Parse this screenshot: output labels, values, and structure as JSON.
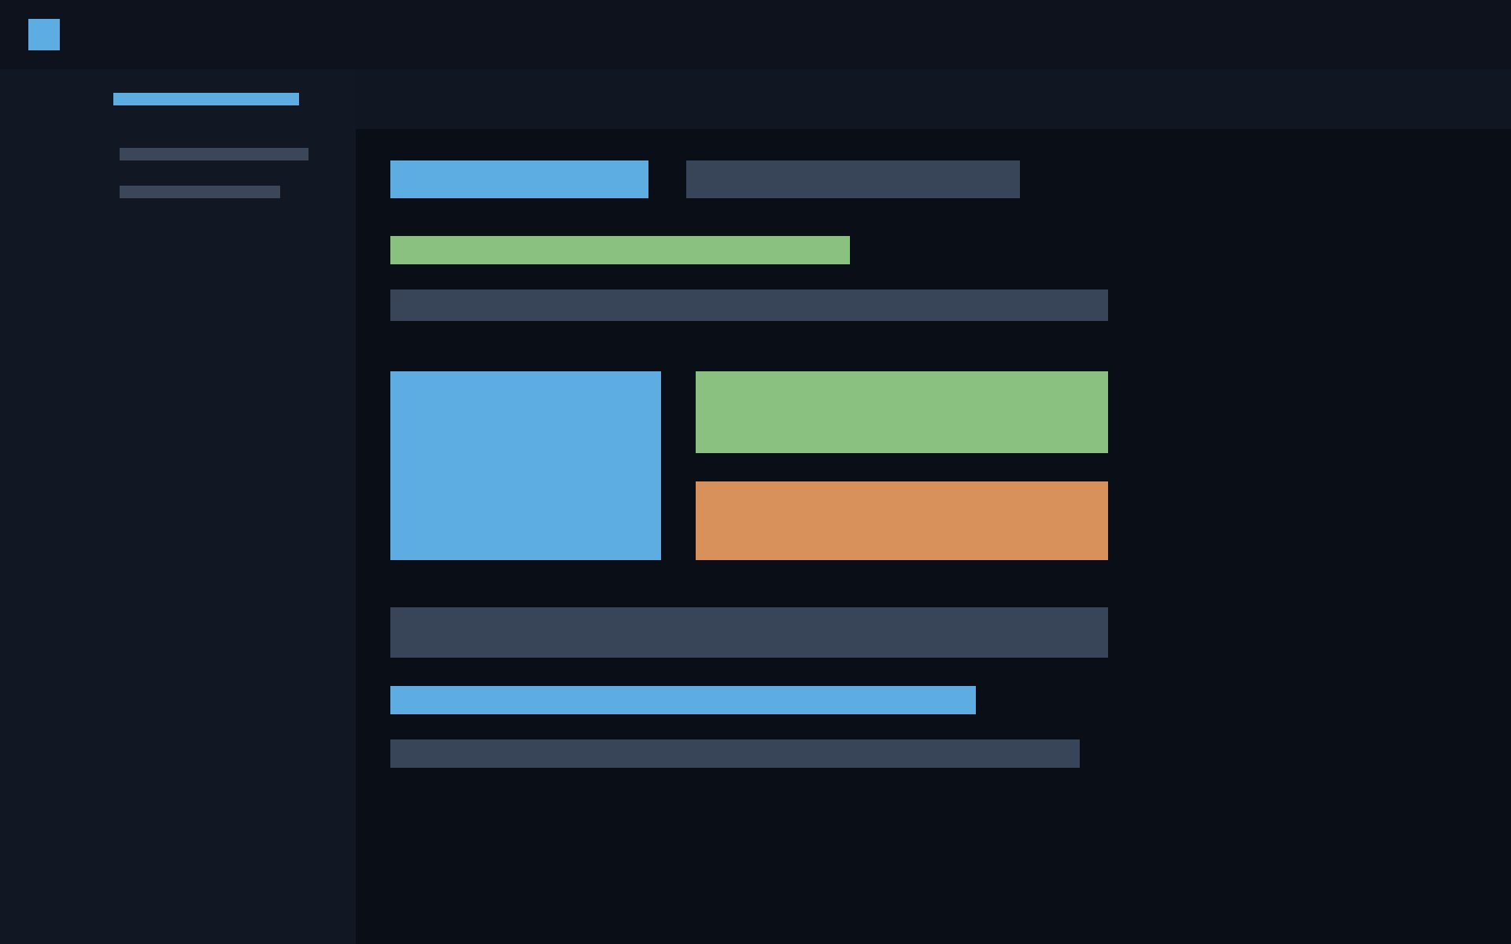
{
  "sidebar": {
    "items": [
      {
        "selected": true
      },
      {
        "selected": false
      },
      {
        "selected": false
      }
    ]
  },
  "content": {
    "blocks": [
      {
        "color": "#5dade2"
      },
      {
        "color": "#384558"
      },
      {
        "color": "#8bc180"
      },
      {
        "color": "#384558"
      },
      {
        "color": "#5dade2"
      },
      {
        "color": "#8bc180"
      },
      {
        "color": "#d8915a"
      },
      {
        "color": "#384558"
      },
      {
        "color": "#5dade2"
      },
      {
        "color": "#384558"
      }
    ]
  }
}
